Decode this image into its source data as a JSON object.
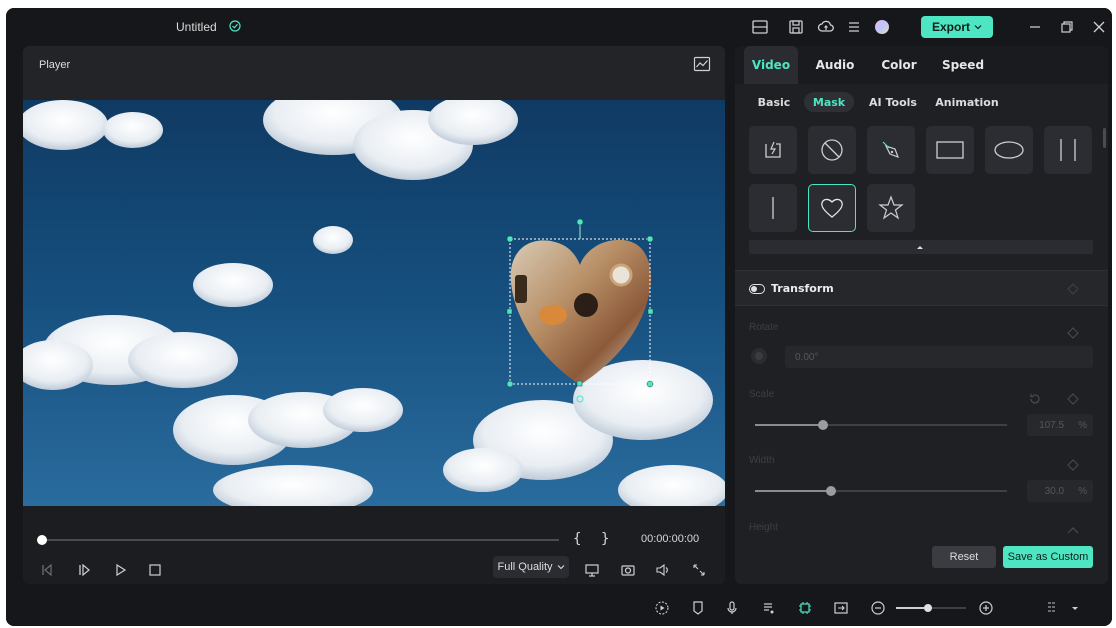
{
  "titlebar": {
    "title": "Untitled",
    "export_label": "Export",
    "icons": [
      "layout-icon",
      "save-icon",
      "cloud-upload-icon",
      "menu-icon",
      "avatar"
    ]
  },
  "player": {
    "title": "Player",
    "timecode": "00:00:00:00",
    "mark_in": "{",
    "mark_out": "}",
    "quality": "Full Quality",
    "playhead_progress": 0.0
  },
  "panel": {
    "tabs": [
      {
        "label": "Video",
        "active": true
      },
      {
        "label": "Audio",
        "active": false
      },
      {
        "label": "Color",
        "active": false
      },
      {
        "label": "Speed",
        "active": false
      }
    ],
    "subtabs": [
      {
        "label": "Basic",
        "active": false
      },
      {
        "label": "Mask",
        "active": true
      },
      {
        "label": "AI Tools",
        "active": false
      },
      {
        "label": "Animation",
        "active": false
      }
    ],
    "masks": [
      {
        "name": "import-mask",
        "selected": false
      },
      {
        "name": "no-mask",
        "selected": false
      },
      {
        "name": "pen-mask",
        "selected": false
      },
      {
        "name": "rectangle-mask",
        "selected": false
      },
      {
        "name": "ellipse-mask",
        "selected": false
      },
      {
        "name": "mirror-mask",
        "selected": false
      },
      {
        "name": "line-mask",
        "selected": false
      },
      {
        "name": "heart-mask",
        "selected": true
      },
      {
        "name": "star-mask",
        "selected": false
      }
    ],
    "transform": {
      "title": "Transform",
      "rotate_label": "Rotate",
      "rotate_value": "0.00°",
      "scale_label": "Scale",
      "scale_value": "107.5",
      "scale_fraction": 0.27,
      "width_label": "Width",
      "width_value": "30.0",
      "width_fraction": 0.3,
      "height_label": "Height",
      "unit": "%"
    },
    "reset_label": "Reset",
    "save_custom_label": "Save as Custom"
  },
  "colors": {
    "accent": "#4ee6c2",
    "background": "#16171a",
    "panel": "#1f2024"
  }
}
